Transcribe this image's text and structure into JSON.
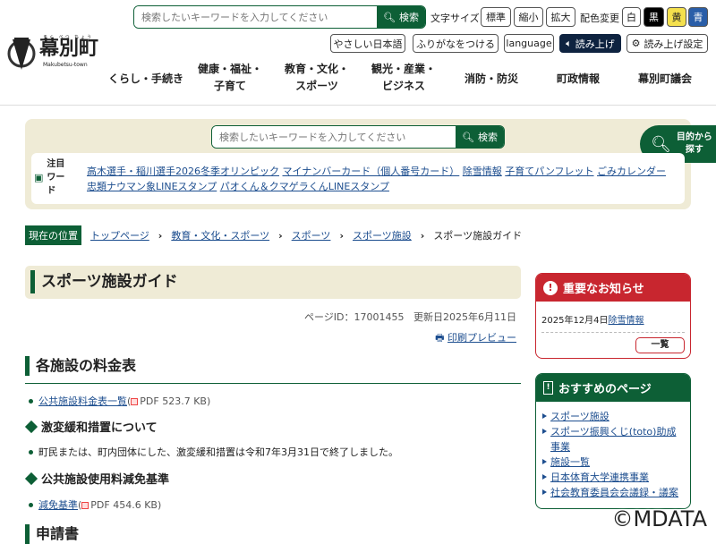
{
  "header": {
    "logo_name": "幕別町",
    "logo_ruby": "まく べつ ちょう",
    "logo_romaji": "Makubetsu-town",
    "search_placeholder": "検索したいキーワードを入力してください",
    "search_button": "検索",
    "font_size_label": "文字サイズ",
    "font_sizes": [
      "標準",
      "縮小",
      "拡大"
    ],
    "color_label": "配色変更",
    "colors": [
      "白",
      "黒",
      "黄",
      "青"
    ],
    "tools": [
      "やさしい日本語",
      "ふりがなをつける",
      "language",
      "読み上げ",
      "読み上げ設定"
    ],
    "nav": [
      [
        "くらし・手続き"
      ],
      [
        "健康・福祉・",
        "子育て"
      ],
      [
        "教育・文化・",
        "スポーツ"
      ],
      [
        "観光・産業・",
        "ビジネス"
      ],
      [
        "消防・防災"
      ],
      [
        "町政情報"
      ],
      [
        "幕別町議会"
      ]
    ]
  },
  "colors": {
    "brand": "#0d5f36",
    "alert": "#c8262f",
    "beige": "#efebd6",
    "navy": "#0e2340"
  },
  "search_area": {
    "placeholder": "検索したいキーワードを入力してください",
    "button": "検索",
    "purpose_tab": [
      "目的から",
      "探す"
    ],
    "keywords_label": [
      "注目",
      "ワー",
      "ド"
    ],
    "keywords": [
      "高木選手・稲川選手2026冬季オリンピック",
      "マイナンバーカード（個人番号カード）",
      "除雪情報",
      "子育てパンフレット",
      "ごみカレンダー",
      "忠類ナウマン象LINEスタンプ",
      "パオくん＆クマゲラくんLINEスタンプ"
    ]
  },
  "breadcrumb": {
    "label": "現在の位置",
    "items": [
      "トップページ",
      "教育・文化・スポーツ",
      "スポーツ",
      "スポーツ施設"
    ],
    "current": "スポーツ施設ガイド"
  },
  "page": {
    "title": "スポーツ施設ガイド",
    "page_id": "ページID：17001455",
    "updated": "更新日2025年6月11日",
    "print": "印刷プレビュー",
    "sec1": "各施設の料金表",
    "link1": "公共施設料金表一覧",
    "link1_size": "PDF 523.7 KB",
    "h3a": "激変緩和措置について",
    "texta": "町民または、町内団体にした、激変緩和措置は令和7年3月31日で終了しました。",
    "h3b": "公共施設使用料減免基準",
    "link2": "減免基準",
    "link2_size": "PDF 454.6 KB",
    "sec2": "申請書"
  },
  "notice": {
    "title": "重要なお知らせ",
    "date": "2025年12月4日",
    "link": "除雪情報",
    "more": "一覧"
  },
  "recommend": {
    "title": "おすすめのページ",
    "items": [
      "スポーツ施設",
      "スポーツ振興くじ(toto)助成事業",
      "施設一覧",
      "日本体育大学連携事業",
      "社会教育委員会会議録・議案"
    ]
  },
  "watermark": "©MDATA"
}
